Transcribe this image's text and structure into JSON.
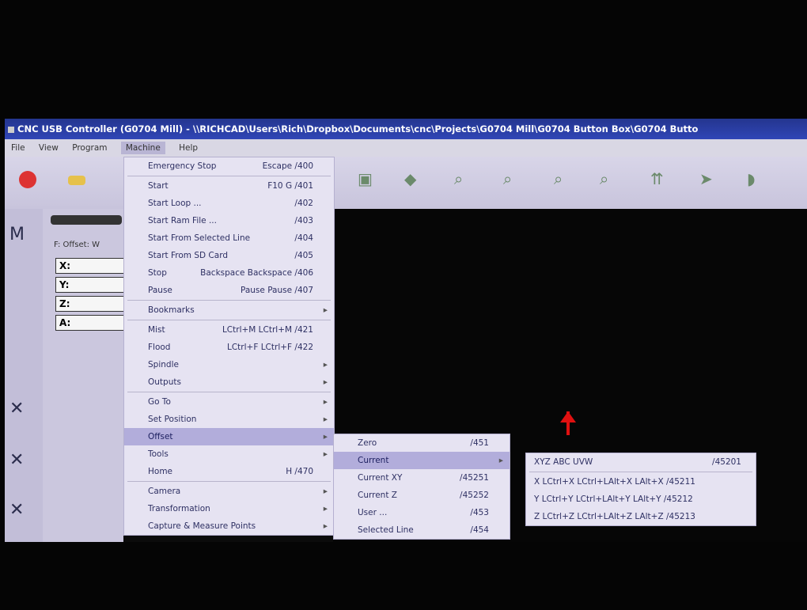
{
  "window": {
    "title": "CNC USB Controller (G0704 Mill) - \\\\RICHCAD\\Users\\Rich\\Dropbox\\Documents\\cnc\\Projects\\G0704 Mill\\G0704 Button Box\\G0704 Butto"
  },
  "menubar": {
    "items": [
      "File",
      "View",
      "Program",
      "Machine",
      "Help"
    ]
  },
  "left_panel": {
    "offset_label": "F: Offset: W",
    "axes": [
      "X:",
      "Y:",
      "Z:",
      "A:"
    ]
  },
  "machine_menu": [
    {
      "label": "Emergency Stop",
      "shortcut": "Escape /400"
    },
    {
      "label": "Start",
      "shortcut": "F10 G /401"
    },
    {
      "label": "Start Loop ...",
      "shortcut": "/402"
    },
    {
      "label": "Start Ram File ...",
      "shortcut": "/403"
    },
    {
      "label": "Start From Selected Line",
      "shortcut": "/404"
    },
    {
      "label": "Start From SD Card",
      "shortcut": "/405"
    },
    {
      "label": "Stop",
      "shortcut": "Backspace Backspace /406"
    },
    {
      "label": "Pause",
      "shortcut": "Pause Pause /407"
    },
    {
      "label": "Bookmarks",
      "submenu": true
    },
    {
      "label": "Mist",
      "shortcut": "LCtrl+M LCtrl+M /421"
    },
    {
      "label": "Flood",
      "shortcut": "LCtrl+F LCtrl+F /422"
    },
    {
      "label": "Spindle",
      "submenu": true
    },
    {
      "label": "Outputs",
      "submenu": true
    },
    {
      "label": "Go To",
      "submenu": true
    },
    {
      "label": "Set Position",
      "submenu": true
    },
    {
      "label": "Offset",
      "submenu": true,
      "highlighted": true
    },
    {
      "label": "Tools",
      "submenu": true
    },
    {
      "label": "Home",
      "shortcut": "H /470"
    },
    {
      "label": "Camera",
      "submenu": true
    },
    {
      "label": "Transformation",
      "submenu": true
    },
    {
      "label": "Capture & Measure Points",
      "submenu": true
    }
  ],
  "offset_menu": [
    {
      "label": "Zero",
      "shortcut": "/451"
    },
    {
      "label": "Current",
      "submenu": true,
      "highlighted": true
    },
    {
      "label": "Current XY",
      "shortcut": "/45251"
    },
    {
      "label": "Current Z",
      "shortcut": "/45252"
    },
    {
      "label": "User ...",
      "shortcut": "/453"
    },
    {
      "label": "Selected Line",
      "shortcut": "/454"
    }
  ],
  "current_menu": [
    {
      "label": "XYZ ABC UVW",
      "shortcut": "/45201"
    },
    {
      "label": "X    LCtrl+X LCtrl+LAlt+X LAlt+X /45211"
    },
    {
      "label": "Y    LCtrl+Y LCtrl+LAlt+Y LAlt+Y /45212"
    },
    {
      "label": "Z    LCtrl+Z LCtrl+LAlt+Z LAlt+Z /45213"
    }
  ]
}
